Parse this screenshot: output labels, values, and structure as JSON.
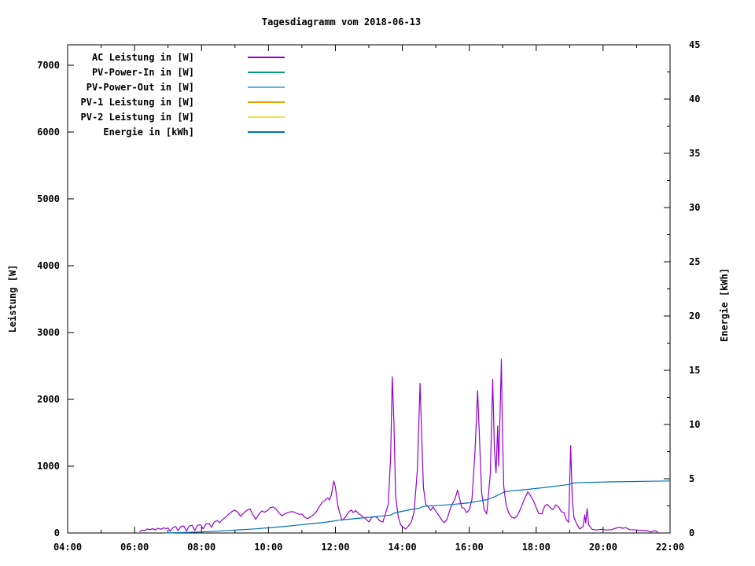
{
  "chart_data": {
    "type": "line",
    "title": "Tagesdiagramm vom 2018-06-13",
    "background_color": "#ffffff",
    "text_color": "#000000",
    "grid": false,
    "legend_position": "top-left-inside",
    "x_axis": {
      "kind": "time-of-day",
      "min_hour": 4,
      "max_hour": 22,
      "major_tick_hours": [
        4,
        6,
        8,
        10,
        12,
        14,
        16,
        18,
        20,
        22
      ],
      "major_tick_labels": [
        "04:00",
        "06:00",
        "08:00",
        "10:00",
        "12:00",
        "14:00",
        "16:00",
        "18:00",
        "20:00",
        "22:00"
      ],
      "minor_tick_step_hours": 1
    },
    "y_left_axis": {
      "label": "Leistung [W]",
      "min": 0,
      "max": 7270,
      "tick_values": [
        0,
        1000,
        2000,
        3000,
        4000,
        5000,
        6000,
        7000
      ],
      "tick_labels": [
        "0",
        "1000",
        "2000",
        "3000",
        "4000",
        "5000",
        "6000",
        "7000"
      ]
    },
    "y_right_axis": {
      "label": "Energie [kWh]",
      "min": 0,
      "max": 45,
      "tick_values": [
        0,
        5,
        10,
        15,
        20,
        25,
        30,
        35,
        40,
        45
      ],
      "tick_labels": [
        "0",
        "5",
        "10",
        "15",
        "20",
        "25",
        "30",
        "35",
        "40",
        "45"
      ],
      "minor_tick_step": 2.5
    },
    "legend": [
      {
        "label": "AC Leistung in [W]",
        "color": "#9400d3"
      },
      {
        "label": "PV-Power-In in [W]",
        "color": "#009e73"
      },
      {
        "label": "PV-Power-Out in [W]",
        "color": "#56b4e9"
      },
      {
        "label": "PV-1 Leistung in [W]",
        "color": "#e69f00"
      },
      {
        "label": "PV-2 Leistung in [W]",
        "color": "#f0e442"
      },
      {
        "label": "Energie in [kWh]",
        "color": "#0072b2"
      }
    ],
    "series": [
      {
        "name": "AC Leistung in [W]",
        "color": "#9400d3",
        "yaxis": "left",
        "unit": "W",
        "x": [
          6.15,
          6.22,
          6.3,
          6.38,
          6.45,
          6.55,
          6.62,
          6.7,
          6.78,
          6.87,
          6.95,
          7.0,
          7.07,
          7.15,
          7.23,
          7.3,
          7.38,
          7.47,
          7.55,
          7.63,
          7.72,
          7.8,
          7.88,
          7.97,
          8.05,
          8.13,
          8.22,
          8.3,
          8.38,
          8.47,
          8.55,
          8.63,
          8.72,
          8.82,
          8.92,
          9.0,
          9.08,
          9.17,
          9.27,
          9.37,
          9.45,
          9.53,
          9.62,
          9.72,
          9.8,
          9.88,
          9.97,
          10.05,
          10.13,
          10.22,
          10.3,
          10.4,
          10.48,
          10.57,
          10.65,
          10.73,
          10.82,
          10.92,
          11.0,
          11.08,
          11.17,
          11.27,
          11.35,
          11.43,
          11.52,
          11.6,
          11.68,
          11.77,
          11.82,
          11.88,
          11.95,
          12.0,
          12.07,
          12.13,
          12.2,
          12.3,
          12.4,
          12.48,
          12.53,
          12.6,
          12.7,
          12.8,
          12.9,
          13.0,
          13.08,
          13.17,
          13.25,
          13.33,
          13.42,
          13.5,
          13.58,
          13.65,
          13.7,
          13.75,
          13.8,
          13.88,
          13.95,
          14.02,
          14.1,
          14.18,
          14.27,
          14.35,
          14.45,
          14.53,
          14.58,
          14.63,
          14.7,
          14.78,
          14.85,
          14.92,
          14.98,
          15.08,
          15.17,
          15.25,
          15.33,
          15.45,
          15.58,
          15.65,
          15.7,
          15.77,
          15.85,
          15.92,
          16.0,
          16.08,
          16.17,
          16.25,
          16.3,
          16.37,
          16.45,
          16.52,
          16.57,
          16.63,
          16.7,
          16.75,
          16.8,
          16.85,
          16.88,
          16.93,
          16.96,
          16.99,
          17.03,
          17.1,
          17.18,
          17.27,
          17.35,
          17.43,
          17.52,
          17.63,
          17.75,
          17.83,
          17.92,
          18.0,
          18.08,
          18.17,
          18.25,
          18.33,
          18.42,
          18.5,
          18.58,
          18.67,
          18.75,
          18.83,
          18.9,
          18.97,
          19.03,
          19.08,
          19.13,
          19.2,
          19.3,
          19.4,
          19.45,
          19.48,
          19.52,
          19.57,
          19.67,
          19.8,
          19.95,
          20.1,
          20.25,
          20.4,
          20.5,
          20.58,
          20.67,
          20.8,
          21.0,
          21.15,
          21.3,
          21.42,
          21.55,
          21.65
        ],
        "y": [
          15,
          45,
          35,
          60,
          50,
          65,
          45,
          70,
          55,
          75,
          65,
          75,
          25,
          85,
          95,
          35,
          95,
          105,
          30,
          105,
          115,
          35,
          115,
          125,
          60,
          135,
          145,
          85,
          165,
          185,
          155,
          205,
          235,
          285,
          325,
          340,
          310,
          250,
          305,
          345,
          360,
          280,
          205,
          285,
          330,
          310,
          335,
          375,
          390,
          365,
          310,
          255,
          285,
          305,
          315,
          320,
          300,
          280,
          285,
          235,
          215,
          245,
          275,
          315,
          395,
          455,
          485,
          525,
          495,
          565,
          780,
          690,
          420,
          295,
          190,
          235,
          315,
          345,
          305,
          335,
          290,
          250,
          215,
          165,
          230,
          245,
          230,
          180,
          165,
          300,
          430,
          1150,
          2340,
          1650,
          560,
          240,
          125,
          90,
          60,
          105,
          165,
          310,
          950,
          2240,
          1450,
          680,
          430,
          390,
          340,
          390,
          340,
          270,
          200,
          155,
          200,
          390,
          520,
          640,
          540,
          390,
          365,
          305,
          345,
          500,
          1200,
          2130,
          1500,
          600,
          345,
          285,
          545,
          900,
          2300,
          1250,
          900,
          1600,
          1000,
          1950,
          2600,
          1550,
          700,
          420,
          300,
          235,
          220,
          255,
          350,
          485,
          615,
          560,
          480,
          380,
          290,
          285,
          400,
          430,
          380,
          350,
          420,
          390,
          320,
          305,
          200,
          160,
          1310,
          490,
          230,
          150,
          60,
          95,
          270,
          150,
          365,
          120,
          55,
          45,
          55,
          45,
          50,
          75,
          85,
          70,
          80,
          50,
          45,
          40,
          35,
          15,
          35,
          5
        ]
      },
      {
        "name": "PV-Power-In in [W]",
        "color": "#009e73",
        "yaxis": "left",
        "unit": "W",
        "x": [],
        "y": []
      },
      {
        "name": "PV-Power-Out in [W]",
        "color": "#56b4e9",
        "yaxis": "left",
        "unit": "W",
        "x": [],
        "y": []
      },
      {
        "name": "PV-1 Leistung in [W]",
        "color": "#e69f00",
        "yaxis": "left",
        "unit": "W",
        "x": [],
        "y": []
      },
      {
        "name": "PV-2 Leistung in [W]",
        "color": "#f0e442",
        "yaxis": "left",
        "unit": "W",
        "x": [],
        "y": []
      },
      {
        "name": "Energie in [kWh]",
        "color": "#0072b2",
        "yaxis": "right",
        "unit": "kWh",
        "x": [
          6.9,
          7.25,
          7.6,
          8.0,
          8.4,
          8.8,
          9.2,
          9.6,
          10.0,
          10.4,
          10.8,
          11.2,
          11.6,
          11.9,
          12.1,
          12.5,
          13.0,
          13.4,
          13.65,
          13.8,
          14.0,
          14.3,
          14.5,
          14.62,
          15.0,
          15.5,
          16.0,
          16.3,
          16.5,
          16.7,
          16.9,
          17.05,
          17.3,
          17.6,
          18.0,
          18.4,
          18.8,
          19.0,
          19.08,
          19.4,
          19.8,
          20.2,
          20.8,
          21.4,
          22.0
        ],
        "y": [
          0,
          0.03,
          0.06,
          0.1,
          0.16,
          0.23,
          0.3,
          0.38,
          0.48,
          0.58,
          0.7,
          0.83,
          0.95,
          1.08,
          1.18,
          1.3,
          1.45,
          1.57,
          1.65,
          1.88,
          2.0,
          2.18,
          2.28,
          2.45,
          2.52,
          2.63,
          2.78,
          2.95,
          3.05,
          3.25,
          3.55,
          3.8,
          3.9,
          3.98,
          4.1,
          4.25,
          4.4,
          4.48,
          4.6,
          4.65,
          4.68,
          4.71,
          4.74,
          4.77,
          4.8
        ]
      }
    ]
  }
}
